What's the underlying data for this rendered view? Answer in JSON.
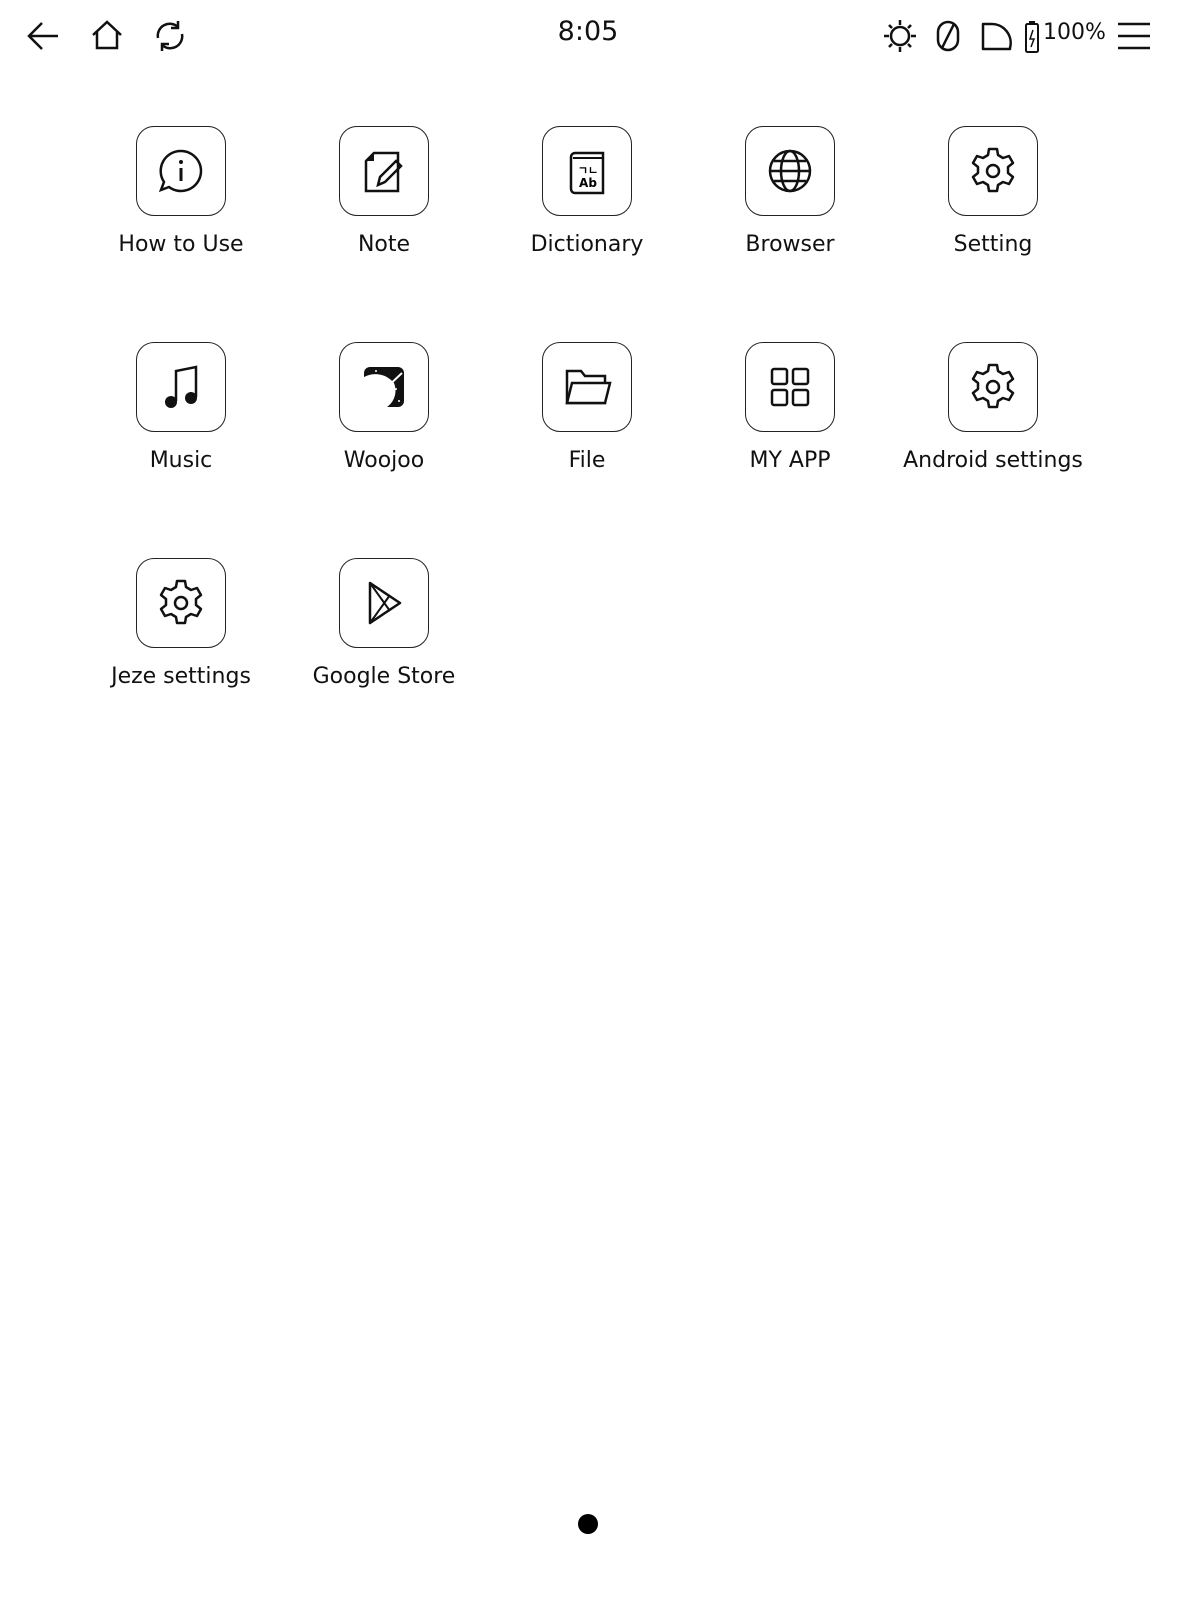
{
  "status_bar": {
    "time": "8:05",
    "battery": "100%",
    "icons": [
      "back-arrow-icon",
      "home-icon",
      "refresh-icon",
      "brightness-icon",
      "rotation-lock-icon",
      "quarter-circle-icon",
      "battery-charging-icon",
      "menu-icon"
    ]
  },
  "apps": [
    {
      "label": "How to Use",
      "icon": "info-chat-icon"
    },
    {
      "label": "Note",
      "icon": "note-pencil-icon"
    },
    {
      "label": "Dictionary",
      "icon": "dictionary-book-icon",
      "glyph_top": "ㄱㄴ",
      "glyph_bottom": "Ab"
    },
    {
      "label": "Browser",
      "icon": "globe-icon"
    },
    {
      "label": "Setting",
      "icon": "gear-icon"
    },
    {
      "label": "Music",
      "icon": "music-note-icon"
    },
    {
      "label": "Woojoo",
      "icon": "space-planet-icon"
    },
    {
      "label": "File",
      "icon": "folder-icon"
    },
    {
      "label": "MY APP",
      "icon": "grid-icon"
    },
    {
      "label": "Android settings",
      "icon": "gear-icon"
    },
    {
      "label": "Jeze settings",
      "icon": "gear-icon"
    },
    {
      "label": "Google Store",
      "icon": "play-store-icon"
    }
  ],
  "pagination": {
    "current": 1,
    "total": 1
  }
}
